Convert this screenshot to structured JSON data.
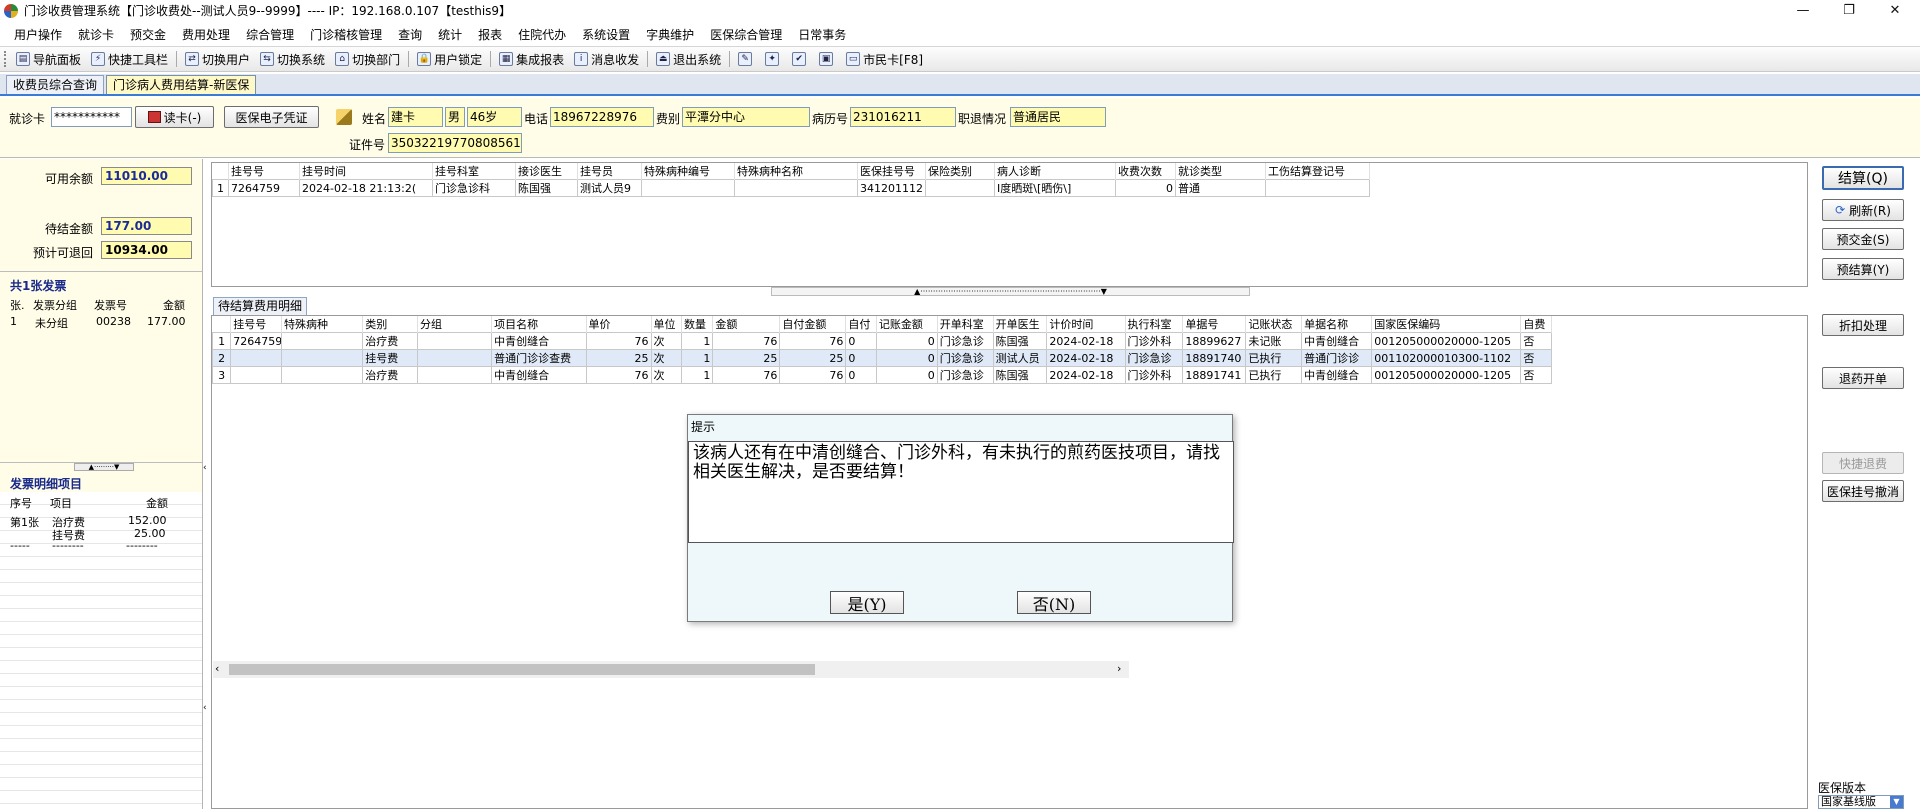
{
  "window": {
    "title": "门诊收费管理系统【门诊收费处--测试人员9--9999】---- IP：192.168.0.107【testhis9】",
    "min": "—",
    "max": "❐",
    "close": "✕"
  },
  "menu": [
    "用户操作",
    "就诊卡",
    "预交金",
    "费用处理",
    "综合管理",
    "门诊稽核管理",
    "查询",
    "统计",
    "报表",
    "住院代办",
    "系统设置",
    "字典维护",
    "医保综合管理",
    "日常事务"
  ],
  "toolbar": {
    "nav": "导航面板",
    "quick": "快捷工具栏",
    "switch_user": "切换用户",
    "switch_system": "切换系统",
    "switch_dept": "切换部门",
    "user_lock": "用户锁定",
    "report": "集成报表",
    "message": "消息收发",
    "exit": "退出系统",
    "citizen_card": "市民卡[F8]"
  },
  "tabs": [
    "收费员综合查询",
    "门诊病人费用结算-新医保"
  ],
  "patient": {
    "card_label": "就诊卡",
    "card_no": "***********",
    "read_card": "读卡(-)",
    "insurance_voucher": "医保电子凭证",
    "name_label": "姓名",
    "name": "建卡",
    "gender": "男",
    "age": "46岁",
    "phone_label": "电话",
    "phone": "18967228976",
    "fee_type_label": "费别",
    "fee_type": "平潭分中心",
    "record_label": "病历号",
    "record_no": "231016211",
    "job_label": "职退情况",
    "job": "普通居民",
    "id_label": "证件号",
    "id_no": "350322197708085610"
  },
  "balance": {
    "available_label": "可用余额",
    "available": "11010.00",
    "pending_label": "待结金额",
    "pending": "177.00",
    "refundable_label": "预计可退回",
    "refundable": "10934.00"
  },
  "invoices": {
    "title": "共1张发票",
    "headers": [
      "张.",
      "发票分组",
      "发票号",
      "金额"
    ],
    "rows": [
      [
        "1",
        "未分组",
        "00238",
        "177.00"
      ]
    ]
  },
  "invoice_items": {
    "title": "发票明细项目",
    "headers": [
      "序号",
      "项目",
      "金额"
    ],
    "rows": [
      [
        "第1张",
        "治疗费",
        "152.00"
      ],
      [
        "",
        "挂号费",
        "25.00"
      ],
      [
        "-----",
        "--------",
        "--------"
      ]
    ]
  },
  "registration": {
    "headers": [
      "挂号号",
      "挂号时间",
      "挂号科室",
      "接诊医生",
      "挂号员",
      "特殊病种编号",
      "特殊病种名称",
      "医保挂号号",
      "保险类别",
      "病人诊断",
      "收费次数",
      "就诊类型",
      "工伤结算登记号"
    ],
    "rows": [
      [
        "1",
        "7264759",
        "2024-02-18 21:13:2(",
        "门诊急诊科",
        "陈国强",
        "测试人员9",
        "",
        "",
        "341201112",
        "",
        "Ⅰ度晒斑\\[晒伤\\]",
        "0",
        "普通",
        ""
      ]
    ]
  },
  "detail": {
    "tab": "待结算费用明细",
    "headers": [
      "挂号号",
      "特殊病种",
      "类别",
      "分组",
      "项目名称",
      "单价",
      "单位",
      "数量",
      "金额",
      "自付金额",
      "自付",
      "记账金额",
      "开单科室",
      "开单医生",
      "计价时间",
      "执行科室",
      "单据号",
      "记账状态",
      "单据名称",
      "国家医保编码",
      "自费"
    ],
    "rows": [
      [
        "1",
        "7264759",
        "",
        "治疗费",
        "",
        "中青创缝合",
        "76",
        "次",
        "1",
        "76",
        "76",
        "0",
        "0",
        "门诊急诊",
        "陈国强",
        "2024-02-18",
        "门诊外科",
        "18899627",
        "未记账",
        "中青创缝合",
        "001205000020000-1205",
        "否"
      ],
      [
        "2",
        "",
        "",
        "挂号费",
        "",
        "普通门诊诊查费",
        "25",
        "次",
        "1",
        "25",
        "25",
        "0",
        "0",
        "门诊急诊",
        "测试人员",
        "2024-02-18",
        "门诊急诊",
        "18891740",
        "已执行",
        "普通门诊诊",
        "001102000010300-1102",
        "否"
      ],
      [
        "3",
        "",
        "",
        "治疗费",
        "",
        "中青创缝合",
        "76",
        "次",
        "1",
        "76",
        "76",
        "0",
        "0",
        "门诊急诊",
        "陈国强",
        "2024-02-18",
        "门诊外科",
        "18891741",
        "已执行",
        "中青创缝合",
        "001205000020000-1205",
        "否"
      ]
    ]
  },
  "actions": {
    "settle": "结算(Q)",
    "refresh": "刷新(R)",
    "prepay": "预交金(S)",
    "pre_settle": "预结算(Y)",
    "discount": "折扣处理",
    "return_drug": "退药开单",
    "quick_refund": "快捷退费",
    "cancel_reg": "医保挂号撤消"
  },
  "insurance_version": {
    "label": "医保版本",
    "value": "国家基线版"
  },
  "dialog": {
    "title": "提示",
    "message": "该病人还有在中清创缝合、门诊外科，有未执行的煎药医技项目，请找相关医生解决，是否要结算！",
    "yes": "是(Y)",
    "no": "否(N)"
  }
}
